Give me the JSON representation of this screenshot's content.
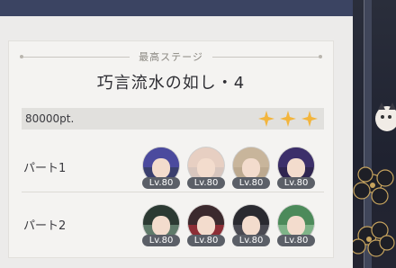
{
  "stage": {
    "subtitle": "最高ステージ",
    "title": "巧言流水の如し・4",
    "score": "80000pt.",
    "stars": 3,
    "star_color": "#f3b53c"
  },
  "parties": [
    {
      "label": "パート1",
      "members": [
        {
          "level": "Lv.80",
          "hair": "#4b4a9e",
          "bg": "#3a3f6e"
        },
        {
          "level": "Lv.80",
          "hair": "#e7cfc2",
          "bg": "#d8c6be"
        },
        {
          "level": "Lv.80",
          "hair": "#c8b59b",
          "bg": "#bca98f"
        },
        {
          "level": "Lv.80",
          "hair": "#3c2f6a",
          "bg": "#2f2550"
        }
      ]
    },
    {
      "label": "パート2",
      "members": [
        {
          "level": "Lv.80",
          "hair": "#2c3a33",
          "bg": "#5f7a6a"
        },
        {
          "level": "Lv.80",
          "hair": "#3b2a2e",
          "bg": "#8c2e36"
        },
        {
          "level": "Lv.80",
          "hair": "#2a2a30",
          "bg": "#4a4a52"
        },
        {
          "level": "Lv.80",
          "hair": "#4c8a5a",
          "bg": "#7fb388"
        }
      ]
    }
  ]
}
